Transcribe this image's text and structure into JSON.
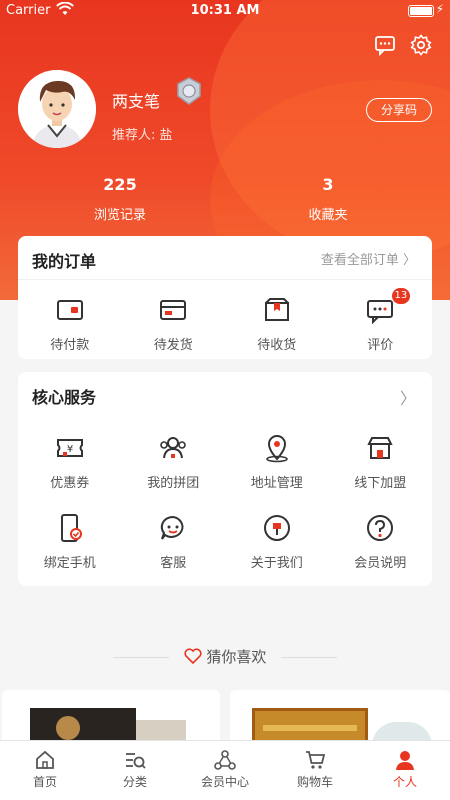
{
  "status_bar": {
    "carrier": "Carrier",
    "time": "10:31 AM"
  },
  "profile": {
    "name": "两支笔",
    "referrer": "推荐人: 盐",
    "share_label": "分享码"
  },
  "stats": [
    {
      "value": "225",
      "label": "浏览记录"
    },
    {
      "value": "3",
      "label": "收藏夹"
    }
  ],
  "orders": {
    "title": "我的订单",
    "view_all": "查看全部订单 〉",
    "items": [
      {
        "label": "待付款",
        "icon": "wallet-icon"
      },
      {
        "label": "待发货",
        "icon": "card-icon"
      },
      {
        "label": "待收货",
        "icon": "box-icon"
      },
      {
        "label": "评价",
        "icon": "comment-icon",
        "badge": "13"
      }
    ]
  },
  "services": {
    "title": "核心服务",
    "items": [
      {
        "label": "优惠券",
        "icon": "coupon-icon"
      },
      {
        "label": "我的拼团",
        "icon": "group-icon"
      },
      {
        "label": "地址管理",
        "icon": "location-icon"
      },
      {
        "label": "线下加盟",
        "icon": "store-icon"
      },
      {
        "label": "绑定手机",
        "icon": "phone-icon"
      },
      {
        "label": "客服",
        "icon": "service-icon"
      },
      {
        "label": "关于我们",
        "icon": "about-icon"
      },
      {
        "label": "会员说明",
        "icon": "help-icon"
      }
    ]
  },
  "recommend": {
    "title": "猜你喜欢"
  },
  "tabbar": [
    {
      "label": "首页",
      "icon": "home-icon"
    },
    {
      "label": "分类",
      "icon": "category-icon"
    },
    {
      "label": "会员中心",
      "icon": "member-icon"
    },
    {
      "label": "购物车",
      "icon": "cart-icon"
    },
    {
      "label": "个人",
      "icon": "person-icon",
      "active": true
    }
  ],
  "colors": {
    "accent": "#e8351f",
    "text": "#333333",
    "muted": "#999999"
  }
}
